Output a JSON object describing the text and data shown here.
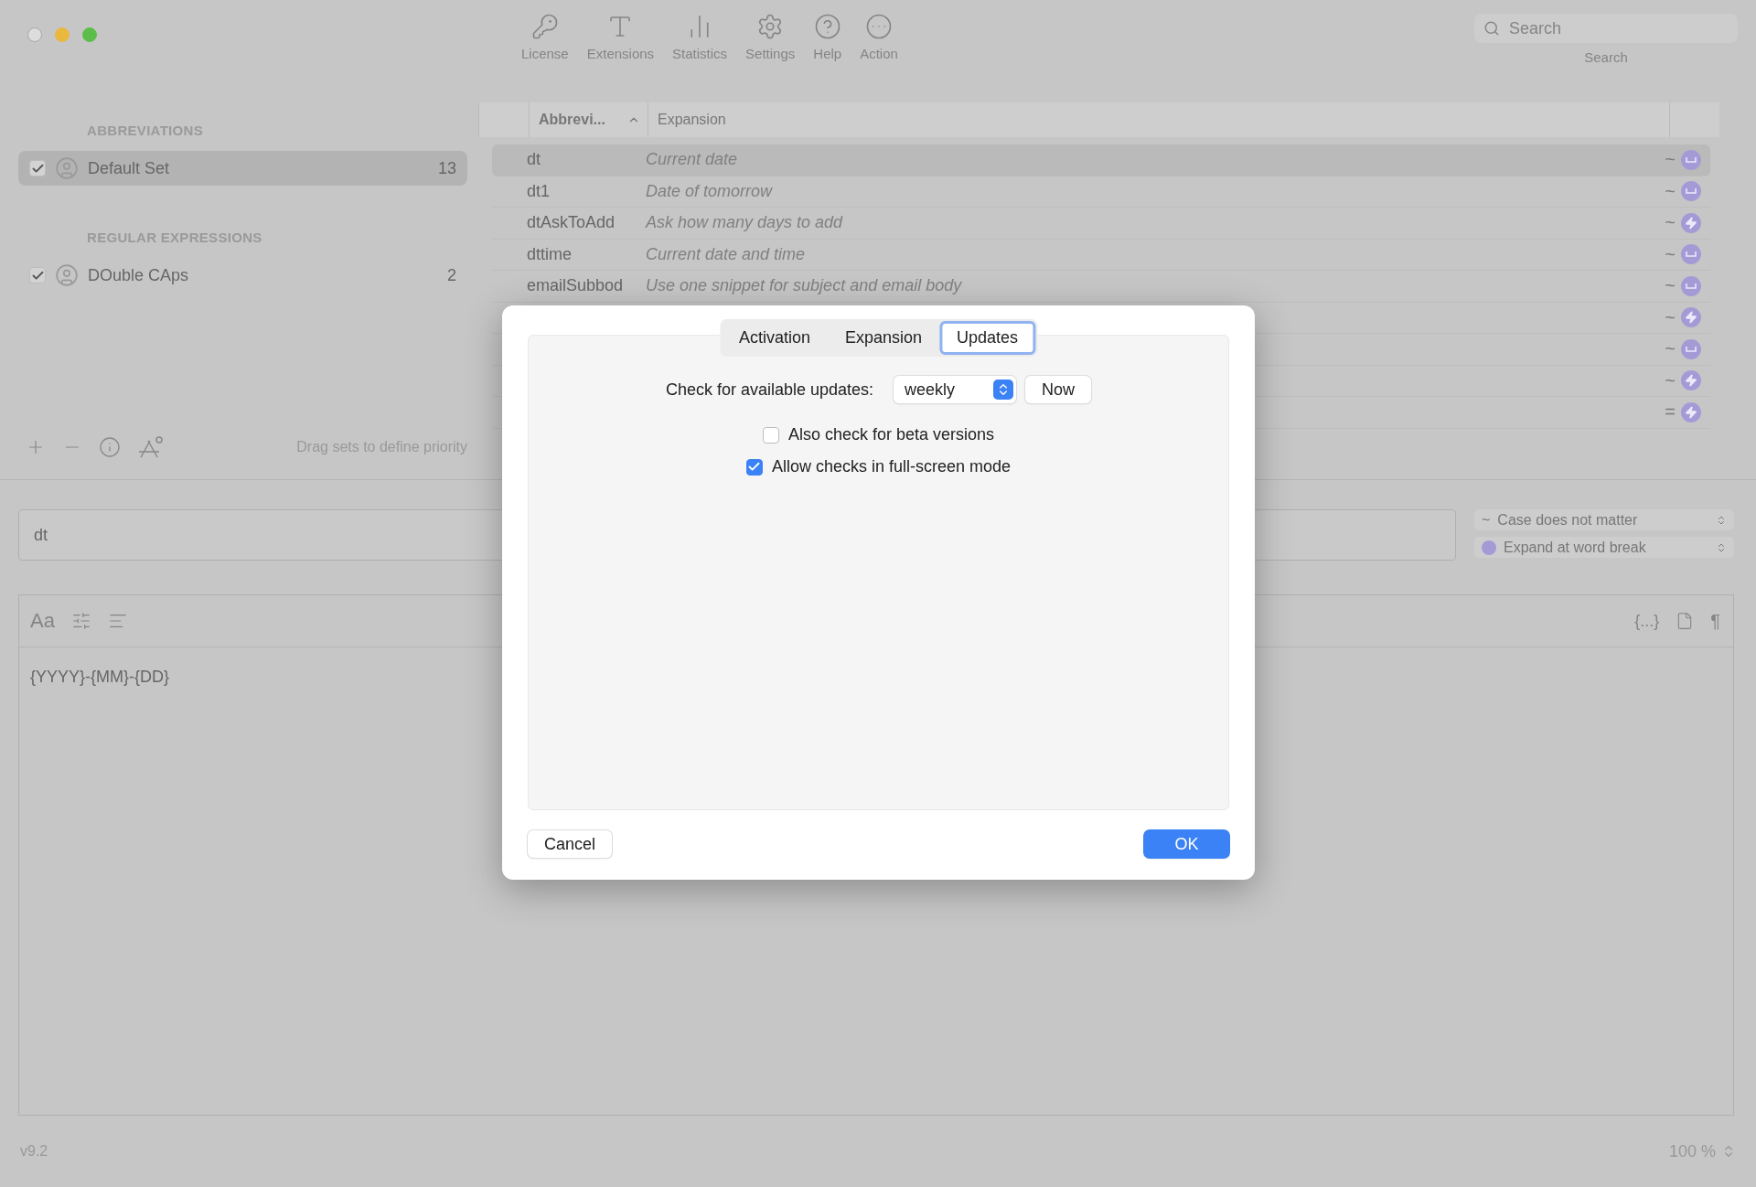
{
  "toolbar": [
    {
      "kind": "key",
      "label": "License"
    },
    {
      "kind": "extensions",
      "label": "Extensions"
    },
    {
      "kind": "statistics",
      "label": "Statistics"
    },
    {
      "kind": "settings",
      "label": "Settings"
    },
    {
      "kind": "help",
      "label": "Help"
    },
    {
      "kind": "action",
      "label": "Action"
    }
  ],
  "search": {
    "placeholder": "Search",
    "label": "Search"
  },
  "sidebar": {
    "sections": [
      {
        "title": "ABBREVIATIONS",
        "items": [
          {
            "name": "Default Set",
            "count": "13",
            "checked": true,
            "selected": true
          }
        ]
      },
      {
        "title": "REGULAR EXPRESSIONS",
        "items": [
          {
            "name": "DOuble CAps",
            "count": "2",
            "checked": true,
            "selected": false
          }
        ]
      }
    ],
    "hint": "Drag sets to define priority"
  },
  "table": {
    "columns": [
      {
        "label": "Abbrevi...",
        "sorted": true
      },
      {
        "label": "Expansion",
        "sorted": false
      }
    ],
    "rows": [
      {
        "abbreviation": "dt",
        "expansion": "Current date",
        "case_mark": "~",
        "kind": "space",
        "selected": true
      },
      {
        "abbreviation": "dt1",
        "expansion": "Date of tomorrow",
        "case_mark": "~",
        "kind": "space",
        "selected": false
      },
      {
        "abbreviation": "dtAskToAdd",
        "expansion": "Ask how many days to add",
        "case_mark": "~",
        "kind": "bolt",
        "selected": false
      },
      {
        "abbreviation": "dttime",
        "expansion": "Current date and time",
        "case_mark": "~",
        "kind": "space",
        "selected": false
      },
      {
        "abbreviation": "emailSubbod",
        "expansion": "Use one snippet for subject and email body",
        "case_mark": "~",
        "kind": "space",
        "selected": false
      },
      {
        "case_mark": "~",
        "kind": "bolt",
        "selected": false
      },
      {
        "case_mark": "~",
        "kind": "space",
        "selected": false
      },
      {
        "case_mark": "~",
        "kind": "bolt",
        "selected": false
      },
      {
        "case_mark": "=",
        "kind": "bolt",
        "selected": false
      }
    ]
  },
  "editor": {
    "abbreviation": "dt",
    "case_mark": "~",
    "case_option": "Case does not matter",
    "expand_option": "Expand at word break",
    "format_label": "Aa",
    "token_label": "{...}",
    "pilcrow": "¶",
    "content": "{YYYY}-{MM}-{DD}"
  },
  "footer": {
    "version": "v9.2",
    "zoom": "100 %"
  },
  "dialog": {
    "tabs": [
      {
        "label": "Activation",
        "selected": false
      },
      {
        "label": "Expansion",
        "selected": false
      },
      {
        "label": "Updates",
        "selected": true
      }
    ],
    "check_label": "Check for available updates:",
    "frequency": "weekly",
    "now_button": "Now",
    "options": [
      {
        "label": "Also check for beta versions",
        "checked": false
      },
      {
        "label": "Allow checks in full-screen mode",
        "checked": true
      }
    ],
    "cancel": "Cancel",
    "ok": "OK"
  }
}
